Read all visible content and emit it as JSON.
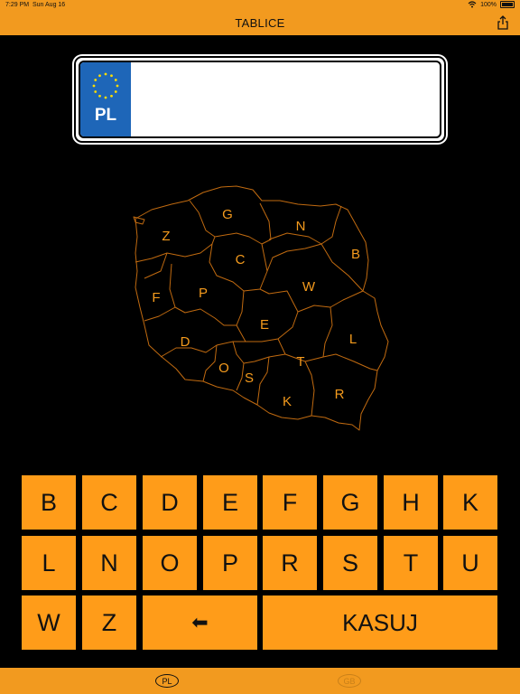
{
  "status_bar": {
    "time": "7:29 PM",
    "date": "Sun Aug 16",
    "battery": "100%"
  },
  "nav": {
    "title": "TABLICE"
  },
  "plate": {
    "country_code": "PL",
    "text": ""
  },
  "map": {
    "region_labels": [
      "G",
      "N",
      "Z",
      "B",
      "C",
      "F",
      "P",
      "W",
      "E",
      "L",
      "D",
      "O",
      "T",
      "S",
      "K",
      "R"
    ]
  },
  "keyboard": {
    "row1": [
      "B",
      "C",
      "D",
      "E",
      "F",
      "G",
      "H",
      "K"
    ],
    "row2": [
      "L",
      "N",
      "O",
      "P",
      "R",
      "S",
      "T",
      "U"
    ],
    "row3": [
      "W",
      "Z"
    ],
    "backspace": "⬅",
    "clear": "KASUJ"
  },
  "tabs": {
    "active": "PL",
    "inactive": "GB"
  },
  "colors": {
    "accent": "#f29a1f",
    "key": "#ff9c19",
    "eu_blue": "#1e66b8"
  }
}
